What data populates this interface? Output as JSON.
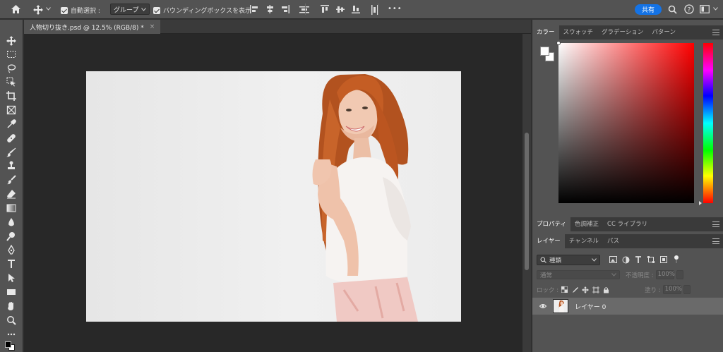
{
  "options_bar": {
    "auto_select_label": "自動選択 :",
    "auto_select_value": "グループ",
    "bounding_box_label": "バウンディングボックスを表示",
    "more_label": "•••",
    "share_label": "共有"
  },
  "document": {
    "tab_title": "人物切り抜き.psd @ 12.5% (RGB/8) *",
    "close_label": "×"
  },
  "color_panel": {
    "tabs": [
      "カラー",
      "スウォッチ",
      "グラデーション",
      "パターン"
    ],
    "active_tab": "カラー",
    "foreground": "#ffffff",
    "background": "#ffffff"
  },
  "properties_panel": {
    "tabs": [
      "プロパティ",
      "色調補正",
      "CC ライブラリ"
    ],
    "active_tab": "プロパティ"
  },
  "layers_panel": {
    "tabs": [
      "レイヤー",
      "チャンネル",
      "パス"
    ],
    "active_tab": "レイヤー",
    "kind_filter": "種類",
    "blend_mode": "通常",
    "opacity_label": "不透明度 :",
    "opacity_value": "100%",
    "lock_label": "ロック :",
    "fill_label": "塗り :",
    "fill_value": "100%",
    "layers": [
      {
        "name": "レイヤー 0",
        "visible": true
      }
    ]
  }
}
